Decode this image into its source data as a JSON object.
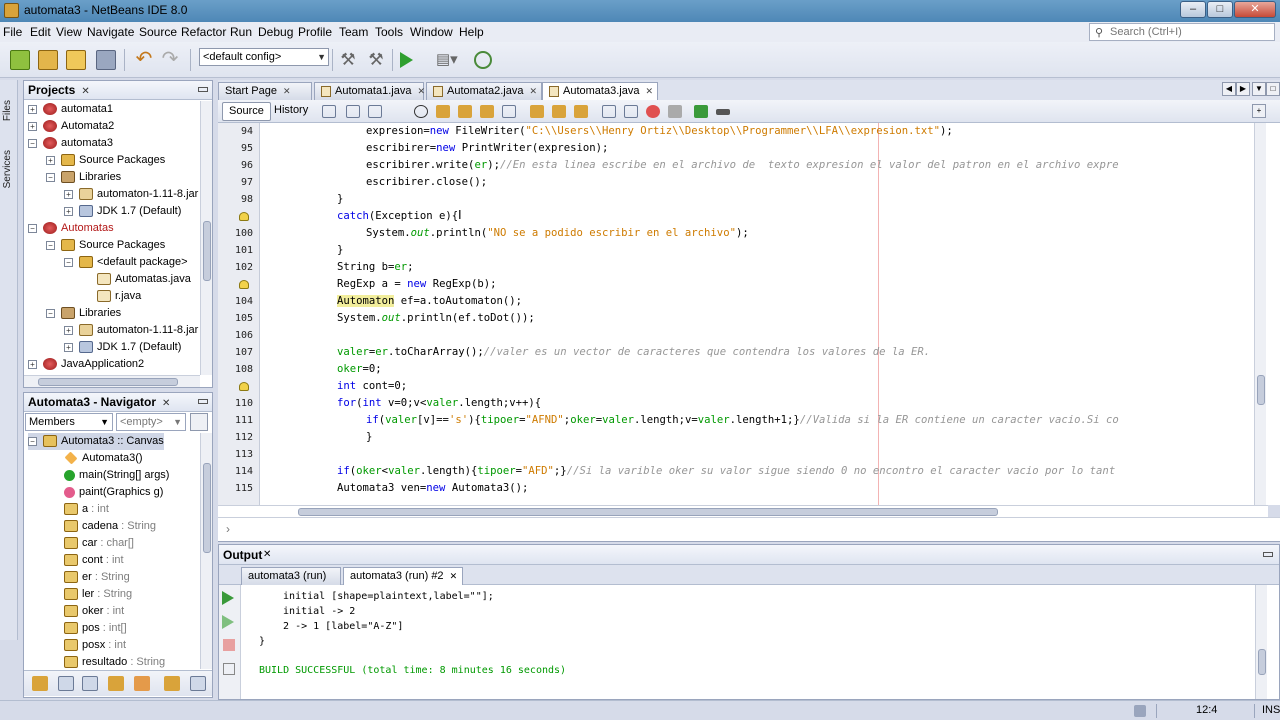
{
  "window": {
    "title": "automata3 - NetBeans IDE 8.0",
    "buttons": [
      "–",
      "□",
      "✕"
    ]
  },
  "menubar": {
    "items": [
      "File",
      "Edit",
      "View",
      "Navigate",
      "Source",
      "Refactor",
      "Run",
      "Debug",
      "Profile",
      "Team",
      "Tools",
      "Window",
      "Help"
    ],
    "search_placeholder": "Search (Ctrl+I)"
  },
  "toolbar": {
    "config": "<default config>"
  },
  "side_tabs": [
    "Files",
    "Services"
  ],
  "projects": {
    "title": "Projects",
    "tree": [
      {
        "label": "automata1",
        "icon": "project-icon",
        "toggle": "+"
      },
      {
        "label": "Automata2",
        "icon": "project-icon",
        "toggle": "+"
      },
      {
        "label": "automata3",
        "icon": "project-icon",
        "toggle": "-"
      },
      {
        "label": "Source Packages",
        "icon": "package-folder-icon",
        "toggle": "+"
      },
      {
        "label": "Libraries",
        "icon": "library-icon",
        "toggle": "-"
      },
      {
        "label": "automaton-1.11-8.jar",
        "icon": "jar-icon",
        "toggle": "+"
      },
      {
        "label": "JDK 1.7 (Default)",
        "icon": "jdk-icon",
        "toggle": "+"
      },
      {
        "label": "Automatas",
        "icon": "project-icon",
        "toggle": "-"
      },
      {
        "label": "Source Packages",
        "icon": "package-folder-icon",
        "toggle": "-"
      },
      {
        "label": "<default package>",
        "icon": "package-icon",
        "toggle": "-"
      },
      {
        "label": "Automatas.java",
        "icon": "java-file-icon",
        "toggle": ""
      },
      {
        "label": "r.java",
        "icon": "java-file-icon",
        "toggle": ""
      },
      {
        "label": "Libraries",
        "icon": "library-icon",
        "toggle": "-"
      },
      {
        "label": "automaton-1.11-8.jar",
        "icon": "jar-icon",
        "toggle": "+"
      },
      {
        "label": "JDK 1.7 (Default)",
        "icon": "jdk-icon",
        "toggle": "+"
      },
      {
        "label": "JavaApplication2",
        "icon": "project-icon",
        "toggle": "+"
      }
    ]
  },
  "navigator": {
    "title": "Automata3 - Navigator",
    "members_label": "Members",
    "filter": "<empty>",
    "items": [
      {
        "name": "Automata3 :: Canvas",
        "type": "",
        "icon": "class-icon"
      },
      {
        "name": "Automata3()",
        "type": "",
        "icon": "constructor-icon"
      },
      {
        "name": "main(String[] args)",
        "type": "",
        "icon": "method-icon"
      },
      {
        "name": "paint(Graphics g)",
        "type": "",
        "icon": "method-icon"
      },
      {
        "name": "a",
        "type": " : int",
        "icon": "field-icon"
      },
      {
        "name": "cadena",
        "type": " : String",
        "icon": "field-icon"
      },
      {
        "name": "car",
        "type": " : char[]",
        "icon": "field-icon"
      },
      {
        "name": "cont",
        "type": " : int",
        "icon": "field-icon"
      },
      {
        "name": "er",
        "type": " : String",
        "icon": "field-icon"
      },
      {
        "name": "ler",
        "type": " : String",
        "icon": "field-icon"
      },
      {
        "name": "oker",
        "type": " : int",
        "icon": "field-icon"
      },
      {
        "name": "pos",
        "type": " : int[]",
        "icon": "field-icon"
      },
      {
        "name": "posx",
        "type": " : int",
        "icon": "field-icon"
      },
      {
        "name": "resultado",
        "type": " : String",
        "icon": "field-icon"
      }
    ]
  },
  "editor": {
    "tabs": [
      "Start Page",
      "Automata1.java",
      "Automata2.java",
      "Automata3.java"
    ],
    "active_tab": 3,
    "views": [
      "Source",
      "History"
    ],
    "line_numbers": [
      "94",
      "95",
      "96",
      "97",
      "98",
      "99",
      "100",
      "101",
      "102",
      "103",
      "104",
      "105",
      "106",
      "107",
      "108",
      "109",
      "110",
      "111",
      "112",
      "113",
      "114",
      "115"
    ],
    "cursor": "12:4"
  },
  "output": {
    "title": "Output",
    "tabs": [
      "automata3 (run)",
      "automata3 (run) #2"
    ],
    "lines": [
      "  initial [shape=plaintext,label=\"\"];",
      "  initial -> 2",
      "  2 -> 1 [label=\"A-Z\"]",
      "}",
      "",
      "BUILD SUCCESSFUL (total time: 8 minutes 16 seconds)"
    ]
  },
  "status": {
    "position": "12:4",
    "mode": "INS"
  }
}
